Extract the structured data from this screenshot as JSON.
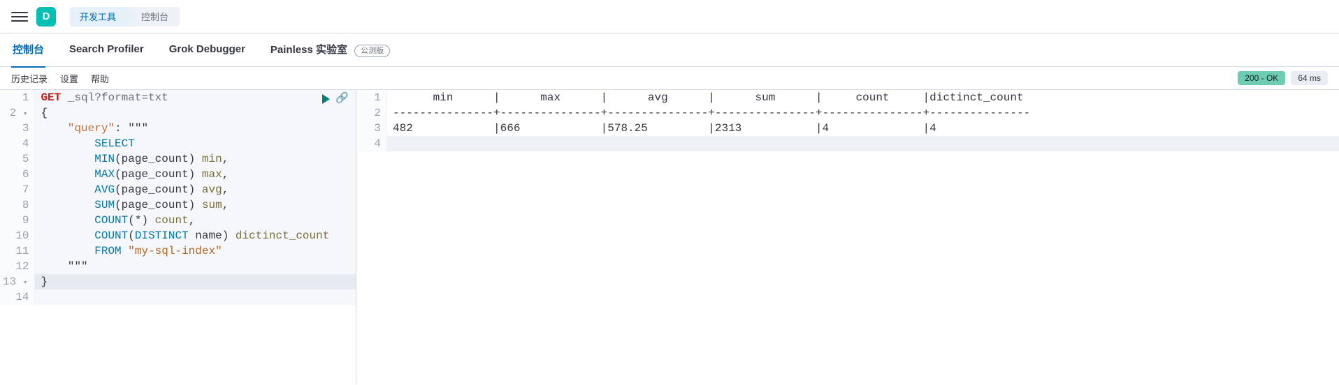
{
  "header": {
    "logo_letter": "D",
    "breadcrumb": [
      "开发工具",
      "控制台"
    ]
  },
  "tabs": [
    {
      "label": "控制台",
      "active": true
    },
    {
      "label": "Search Profiler",
      "active": false
    },
    {
      "label": "Grok Debugger",
      "active": false
    },
    {
      "label": "Painless 实验室",
      "active": false,
      "badge": "公测版"
    }
  ],
  "actions": {
    "history": "历史记录",
    "settings": "设置",
    "help": "帮助",
    "status": "200 - OK",
    "time": "64 ms"
  },
  "request": {
    "method": "GET",
    "path": "_sql?format=txt",
    "lines": [
      {
        "n": 1,
        "type": "req"
      },
      {
        "n": 2,
        "type": "open",
        "fold": true,
        "text": "{"
      },
      {
        "n": 3,
        "type": "kv",
        "indent": 4,
        "key": "\"query\"",
        "after": ": \"\"\""
      },
      {
        "n": 4,
        "type": "sql",
        "indent": 8,
        "tokens": [
          {
            "t": "SELECT",
            "c": "kw"
          }
        ]
      },
      {
        "n": 5,
        "type": "sql",
        "indent": 8,
        "tokens": [
          {
            "t": "MIN",
            "c": "kw"
          },
          {
            "t": "(page_count) ",
            "c": "punc"
          },
          {
            "t": "min",
            "c": "id"
          },
          {
            "t": ",",
            "c": "punc"
          }
        ]
      },
      {
        "n": 6,
        "type": "sql",
        "indent": 8,
        "tokens": [
          {
            "t": "MAX",
            "c": "kw"
          },
          {
            "t": "(page_count) ",
            "c": "punc"
          },
          {
            "t": "max",
            "c": "id"
          },
          {
            "t": ",",
            "c": "punc"
          }
        ]
      },
      {
        "n": 7,
        "type": "sql",
        "indent": 8,
        "tokens": [
          {
            "t": "AVG",
            "c": "kw"
          },
          {
            "t": "(page_count) ",
            "c": "punc"
          },
          {
            "t": "avg",
            "c": "id"
          },
          {
            "t": ",",
            "c": "punc"
          }
        ]
      },
      {
        "n": 8,
        "type": "sql",
        "indent": 8,
        "tokens": [
          {
            "t": "SUM",
            "c": "kw"
          },
          {
            "t": "(page_count) ",
            "c": "punc"
          },
          {
            "t": "sum",
            "c": "id"
          },
          {
            "t": ",",
            "c": "punc"
          }
        ]
      },
      {
        "n": 9,
        "type": "sql",
        "indent": 8,
        "tokens": [
          {
            "t": "COUNT",
            "c": "kw"
          },
          {
            "t": "(*) ",
            "c": "punc"
          },
          {
            "t": "count",
            "c": "id"
          },
          {
            "t": ",",
            "c": "punc"
          }
        ]
      },
      {
        "n": 10,
        "type": "sql",
        "indent": 8,
        "tokens": [
          {
            "t": "COUNT",
            "c": "kw"
          },
          {
            "t": "(",
            "c": "punc"
          },
          {
            "t": "DISTINCT",
            "c": "kw"
          },
          {
            "t": " name) ",
            "c": "punc"
          },
          {
            "t": "dictinct_count",
            "c": "id"
          }
        ]
      },
      {
        "n": 11,
        "type": "sql",
        "indent": 8,
        "tokens": [
          {
            "t": "FROM ",
            "c": "kw"
          },
          {
            "t": "\"my-sql-index\"",
            "c": "str"
          }
        ]
      },
      {
        "n": 12,
        "type": "plain",
        "indent": 4,
        "text": "\"\"\""
      },
      {
        "n": 13,
        "type": "close",
        "fold": true,
        "text": "}"
      },
      {
        "n": 14,
        "type": "plain",
        "text": ""
      }
    ]
  },
  "response": {
    "lines": [
      "      min      |      max      |      avg      |      sum      |     count     |dictinct_count ",
      "---------------+---------------+---------------+---------------+---------------+---------------",
      "482            |666            |578.25         |2313           |4              |4              ",
      ""
    ]
  },
  "chart_data": {
    "type": "table",
    "columns": [
      "min",
      "max",
      "avg",
      "sum",
      "count",
      "dictinct_count"
    ],
    "rows": [
      [
        482,
        666,
        578.25,
        2313,
        4,
        4
      ]
    ]
  }
}
